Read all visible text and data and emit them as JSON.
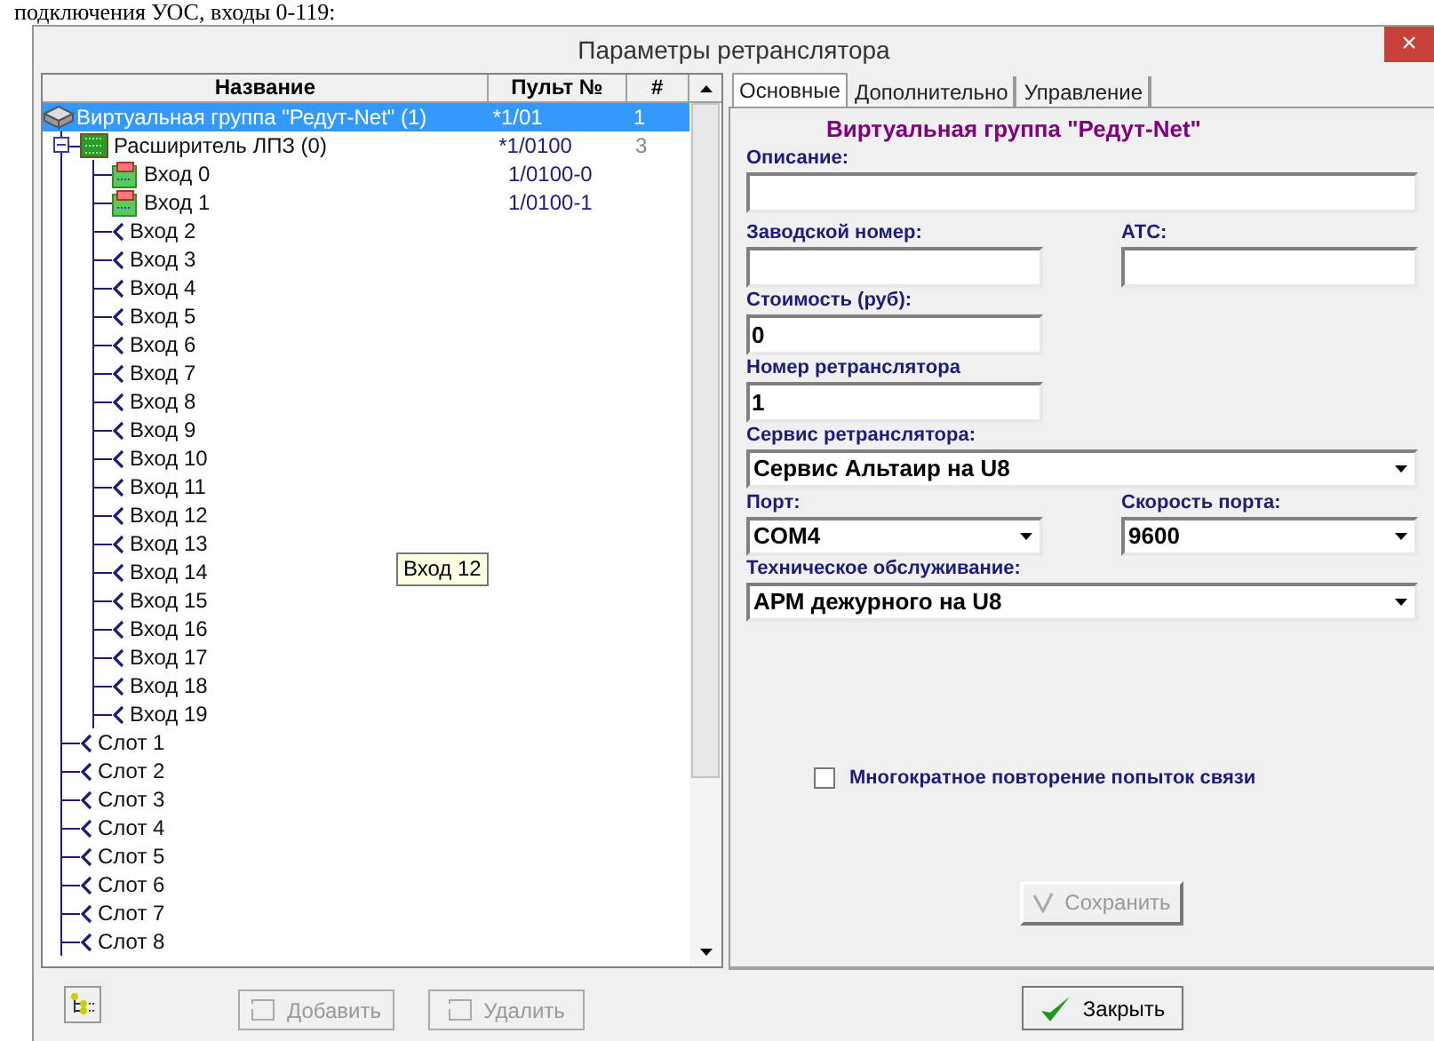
{
  "document_text": "подключения УОС, входы 0-119:",
  "window": {
    "title": "Параметры ретранслятора",
    "close": "×"
  },
  "tree": {
    "columns": [
      "Название",
      "Пульт №",
      "#"
    ],
    "nodes": [
      {
        "kind": "group",
        "name": "Виртуальная группа \"Редут-Net\" (1)",
        "console": "*1/01",
        "number": "1",
        "selected": true,
        "children": [
          {
            "kind": "expander",
            "name": "Расширитель ЛПЗ (0)",
            "console": "*1/0100",
            "number": "3",
            "selected": false,
            "expanded": true,
            "children": [
              {
                "kind": "active_input",
                "name": "Вход 0",
                "console": "1/0100-0",
                "selected": false
              },
              {
                "kind": "active_input",
                "name": "Вход 1",
                "console": "1/0100-1",
                "selected": false
              },
              {
                "kind": "input",
                "name": "Вход 2",
                "selected": false
              },
              {
                "kind": "input",
                "name": "Вход 3",
                "selected": false
              },
              {
                "kind": "input",
                "name": "Вход 4",
                "selected": false
              },
              {
                "kind": "input",
                "name": "Вход 5",
                "selected": false
              },
              {
                "kind": "input",
                "name": "Вход 6",
                "selected": false
              },
              {
                "kind": "input",
                "name": "Вход 7",
                "selected": false
              },
              {
                "kind": "input",
                "name": "Вход 8",
                "selected": false
              },
              {
                "kind": "input",
                "name": "Вход 9",
                "selected": false
              },
              {
                "kind": "input",
                "name": "Вход 10",
                "selected": false
              },
              {
                "kind": "input",
                "name": "Вход 11",
                "selected": false
              },
              {
                "kind": "input",
                "name": "Вход 12",
                "selected": false
              },
              {
                "kind": "input",
                "name": "Вход 13",
                "selected": false
              },
              {
                "kind": "input",
                "name": "Вход 14",
                "selected": false
              },
              {
                "kind": "input",
                "name": "Вход 15",
                "selected": false
              },
              {
                "kind": "input",
                "name": "Вход 16",
                "selected": false
              },
              {
                "kind": "input",
                "name": "Вход 17",
                "selected": false
              },
              {
                "kind": "input",
                "name": "Вход 18",
                "selected": false
              },
              {
                "kind": "input",
                "name": "Вход 19",
                "selected": false
              }
            ]
          },
          {
            "kind": "input",
            "name": "Слот 1",
            "selected": false
          },
          {
            "kind": "input",
            "name": "Слот 2",
            "selected": false
          },
          {
            "kind": "input",
            "name": "Слот 3",
            "selected": false
          },
          {
            "kind": "input",
            "name": "Слот 4",
            "selected": false
          },
          {
            "kind": "input",
            "name": "Слот 5",
            "selected": false
          },
          {
            "kind": "input",
            "name": "Слот 6",
            "selected": false
          },
          {
            "kind": "input",
            "name": "Слот 7",
            "selected": false
          },
          {
            "kind": "input",
            "name": "Слот 8",
            "selected": false
          }
        ]
      }
    ],
    "tooltip": "Вход 12"
  },
  "tabs": [
    {
      "label": "Основные",
      "selected": true
    },
    {
      "label": "Дополнительно",
      "selected": false
    },
    {
      "label": "Управление",
      "selected": false
    }
  ],
  "form": {
    "heading": "Виртуальная группа \"Редут-Net\"",
    "description": {
      "label": "Описание:"
    },
    "serial": {
      "label": "Заводской номер:"
    },
    "exchange": {
      "label": "АТС:"
    },
    "cost": {
      "label": "Стоимость (руб):",
      "value": "0"
    },
    "repeater_number": {
      "label": "Номер ретранслятора",
      "value": "1"
    },
    "service": {
      "label": "Сервис ретранслятора:",
      "value": "Сервис Альтаир на U8"
    },
    "port": {
      "label": "Порт:",
      "value": "COM4"
    },
    "port_speed": {
      "label": "Скорость порта:",
      "value": "9600"
    },
    "maintenance": {
      "label": "Техническое обслуживание:",
      "value": "АРМ дежурного на U8"
    },
    "retry": {
      "label": "Многократное повторение попыток связи",
      "checked": false
    },
    "save": {
      "label": "Сохранить",
      "disabled": true
    }
  },
  "bottom": {
    "add": {
      "label": "Добавить",
      "disabled": true
    },
    "delete": {
      "label": "Удалить",
      "disabled": true
    },
    "close": {
      "label": "Закрыть",
      "disabled": false
    }
  }
}
